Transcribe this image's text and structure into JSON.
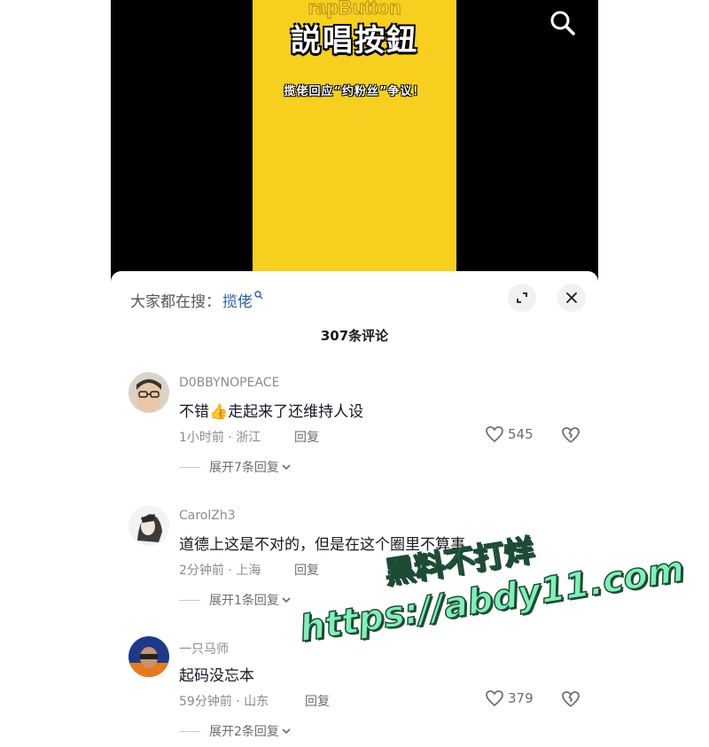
{
  "video": {
    "sub_title": "rapButton",
    "title": "説唱按鈕",
    "caption": "揽佬回应“约粉丝”争议！"
  },
  "sheet": {
    "trending_prefix": "大家都在搜：",
    "trending_keyword": "揽佬",
    "comment_count": "307条评论"
  },
  "comments": [
    {
      "username": "D0BBYNOPEACE",
      "text_before": "不错",
      "emoji": "👍",
      "text_after": "走起来了还维持人设",
      "meta": "1小时前 · 浙江",
      "reply": "回复",
      "likes": "545",
      "expand": "展开7条回复"
    },
    {
      "username": "CarolZh3",
      "text": "道德上这是不对的，但是在这个圈里不算事",
      "meta": "2分钟前 · 上海",
      "reply": "回复",
      "expand": "展开1条回复"
    },
    {
      "username": "一只马师",
      "text": "起码没忘本",
      "meta": "59分钟前 · 山东",
      "reply": "回复",
      "likes": "379",
      "expand": "展开2条回复"
    }
  ],
  "watermark": {
    "line1": "黑料不打烊",
    "line2": "https://abdy11.com"
  },
  "colors": {
    "video_card": "#f7cf1e",
    "keyword_link": "#2a5fa8",
    "watermark": "#7ff0b6"
  }
}
